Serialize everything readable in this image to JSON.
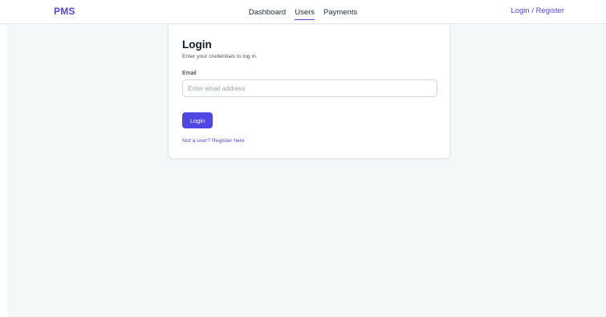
{
  "header": {
    "brand": "PMS",
    "nav": [
      {
        "label": "Dashboard",
        "active": false
      },
      {
        "label": "Users",
        "active": true
      },
      {
        "label": "Payments",
        "active": false
      }
    ],
    "auth_link": "Login / Register"
  },
  "login_card": {
    "title": "Login",
    "subtitle": "Enter your credentials to log in.",
    "email_label": "Email",
    "email_value": "",
    "email_placeholder": "Enter email address",
    "submit_label": "Login",
    "register_link": "Not a user? Register here"
  },
  "colors": {
    "accent": "#4f46e5",
    "page_background": "#f4f8f8",
    "card_background": "#ffffff"
  }
}
